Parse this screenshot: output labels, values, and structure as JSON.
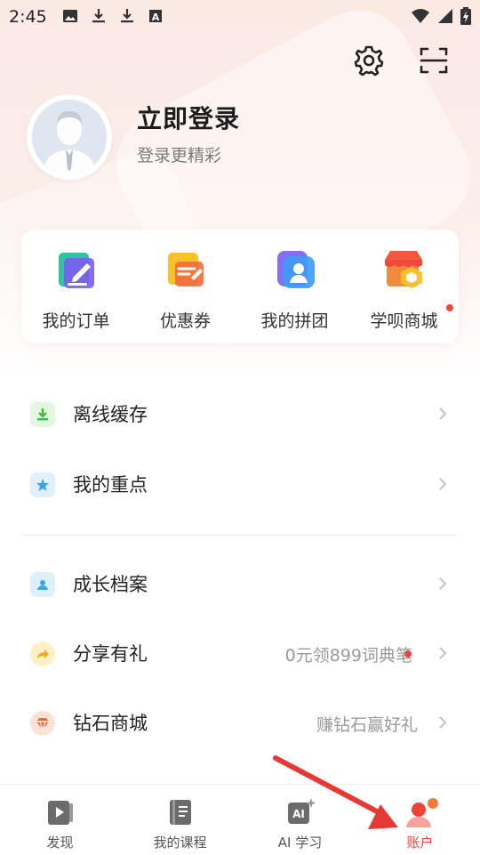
{
  "status_bar": {
    "time": "2:45",
    "left_icons": [
      "image-icon",
      "download-icon",
      "download-icon",
      "a-box-icon"
    ],
    "right_icons": [
      "wifi-icon",
      "signal-icon",
      "battery-charging-icon"
    ]
  },
  "header": {
    "settings_icon": "gear-icon",
    "scan_icon": "scan-icon"
  },
  "profile": {
    "title": "立即登录",
    "subtitle": "登录更精彩"
  },
  "quick_actions": [
    {
      "label": "我的订单",
      "icon": "order-icon"
    },
    {
      "label": "优惠券",
      "icon": "coupon-icon"
    },
    {
      "label": "我的拼团",
      "icon": "group-buy-icon"
    },
    {
      "label": "学呗商城",
      "icon": "store-icon",
      "badge_dot": true
    }
  ],
  "menu": [
    {
      "label": "离线缓存",
      "icon": "download-icon",
      "hint": ""
    },
    {
      "label": "我的重点",
      "icon": "star-bookmark-icon",
      "hint": ""
    },
    {
      "label": "成长档案",
      "icon": "profile-folder-icon",
      "hint": ""
    },
    {
      "label": "分享有礼",
      "icon": "share-arrow-icon",
      "hint": "0元领899词典笔",
      "hint_dot": true
    },
    {
      "label": "钻石商城",
      "icon": "diamond-icon",
      "hint": "赚钻石赢好礼"
    }
  ],
  "bottom_nav": [
    {
      "label": "发现",
      "icon": "play-book-icon",
      "active": false
    },
    {
      "label": "我的课程",
      "icon": "notebook-icon",
      "active": false
    },
    {
      "label": "AI 学习",
      "icon": "ai-sparkle-icon",
      "active": false
    },
    {
      "label": "账户",
      "icon": "account-icon",
      "active": true
    }
  ],
  "colors": {
    "accent": "#f0433a",
    "badge": "#f04545",
    "annotation_arrow": "#e53935"
  }
}
